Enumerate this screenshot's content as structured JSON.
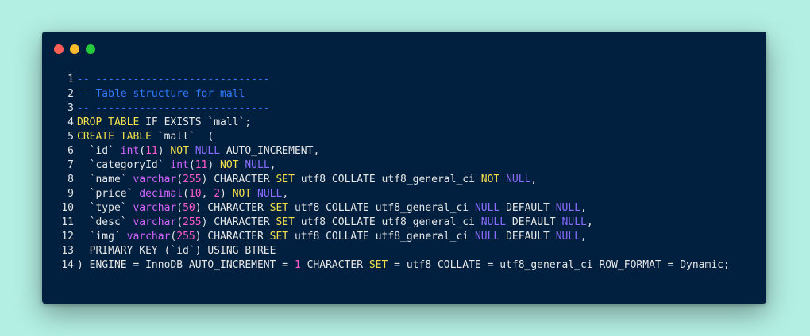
{
  "window": {
    "controls": [
      {
        "name": "close",
        "color": "#ff5f56"
      },
      {
        "name": "minimize",
        "color": "#ffbd2e"
      },
      {
        "name": "maximize",
        "color": "#27c93f"
      }
    ]
  },
  "code": {
    "line_numbers": [
      "1",
      "2",
      "3",
      "4",
      "5",
      "6",
      "7",
      "8",
      "9",
      "10",
      "11",
      "12",
      "13",
      "14"
    ],
    "lines": [
      {
        "segments": [
          {
            "t": "-- ----------------------------",
            "c": "comment"
          }
        ]
      },
      {
        "segments": [
          {
            "t": "-- Table structure for mall",
            "c": "comment"
          }
        ]
      },
      {
        "segments": [
          {
            "t": "-- ----------------------------",
            "c": "comment"
          }
        ]
      },
      {
        "segments": [
          {
            "t": "DROP TABLE",
            "c": "kw"
          },
          {
            "t": " IF EXISTS `mall`;",
            "c": "plain"
          }
        ]
      },
      {
        "segments": [
          {
            "t": "CREATE TABLE",
            "c": "kw"
          },
          {
            "t": " `mall`  (",
            "c": "plain"
          }
        ]
      },
      {
        "segments": [
          {
            "t": "  `id` ",
            "c": "plain"
          },
          {
            "t": "int",
            "c": "type"
          },
          {
            "t": "(",
            "c": "plain"
          },
          {
            "t": "11",
            "c": "num"
          },
          {
            "t": ") ",
            "c": "plain"
          },
          {
            "t": "NOT",
            "c": "kw"
          },
          {
            "t": " ",
            "c": "plain"
          },
          {
            "t": "NULL",
            "c": "null"
          },
          {
            "t": " AUTO_INCREMENT,",
            "c": "plain"
          }
        ]
      },
      {
        "segments": [
          {
            "t": "  `categoryId` ",
            "c": "plain"
          },
          {
            "t": "int",
            "c": "type"
          },
          {
            "t": "(",
            "c": "plain"
          },
          {
            "t": "11",
            "c": "num"
          },
          {
            "t": ") ",
            "c": "plain"
          },
          {
            "t": "NOT",
            "c": "kw"
          },
          {
            "t": " ",
            "c": "plain"
          },
          {
            "t": "NULL",
            "c": "null"
          },
          {
            "t": ",",
            "c": "plain"
          }
        ]
      },
      {
        "segments": [
          {
            "t": "  `name` ",
            "c": "plain"
          },
          {
            "t": "varchar",
            "c": "type"
          },
          {
            "t": "(",
            "c": "plain"
          },
          {
            "t": "255",
            "c": "num"
          },
          {
            "t": ") CHARACTER ",
            "c": "plain"
          },
          {
            "t": "SET",
            "c": "kw"
          },
          {
            "t": " utf8 COLLATE utf8_general_ci ",
            "c": "plain"
          },
          {
            "t": "NOT",
            "c": "kw"
          },
          {
            "t": " ",
            "c": "plain"
          },
          {
            "t": "NULL",
            "c": "null"
          },
          {
            "t": ",",
            "c": "plain"
          }
        ]
      },
      {
        "segments": [
          {
            "t": "  `price` ",
            "c": "plain"
          },
          {
            "t": "decimal",
            "c": "type"
          },
          {
            "t": "(",
            "c": "plain"
          },
          {
            "t": "10",
            "c": "num"
          },
          {
            "t": ", ",
            "c": "plain"
          },
          {
            "t": "2",
            "c": "num"
          },
          {
            "t": ") ",
            "c": "plain"
          },
          {
            "t": "NOT",
            "c": "kw"
          },
          {
            "t": " ",
            "c": "plain"
          },
          {
            "t": "NULL",
            "c": "null"
          },
          {
            "t": ",",
            "c": "plain"
          }
        ]
      },
      {
        "segments": [
          {
            "t": "  `type` ",
            "c": "plain"
          },
          {
            "t": "varchar",
            "c": "type"
          },
          {
            "t": "(",
            "c": "plain"
          },
          {
            "t": "50",
            "c": "num"
          },
          {
            "t": ") CHARACTER ",
            "c": "plain"
          },
          {
            "t": "SET",
            "c": "kw"
          },
          {
            "t": " utf8 COLLATE utf8_general_ci ",
            "c": "plain"
          },
          {
            "t": "NULL",
            "c": "null"
          },
          {
            "t": " DEFAULT ",
            "c": "plain"
          },
          {
            "t": "NULL",
            "c": "null"
          },
          {
            "t": ",",
            "c": "plain"
          }
        ]
      },
      {
        "segments": [
          {
            "t": "  `desc` ",
            "c": "plain"
          },
          {
            "t": "varchar",
            "c": "type"
          },
          {
            "t": "(",
            "c": "plain"
          },
          {
            "t": "255",
            "c": "num"
          },
          {
            "t": ") CHARACTER ",
            "c": "plain"
          },
          {
            "t": "SET",
            "c": "kw"
          },
          {
            "t": " utf8 COLLATE utf8_general_ci ",
            "c": "plain"
          },
          {
            "t": "NULL",
            "c": "null"
          },
          {
            "t": " DEFAULT ",
            "c": "plain"
          },
          {
            "t": "NULL",
            "c": "null"
          },
          {
            "t": ",",
            "c": "plain"
          }
        ]
      },
      {
        "segments": [
          {
            "t": "  `img` ",
            "c": "plain"
          },
          {
            "t": "varchar",
            "c": "type"
          },
          {
            "t": "(",
            "c": "plain"
          },
          {
            "t": "255",
            "c": "num"
          },
          {
            "t": ") CHARACTER ",
            "c": "plain"
          },
          {
            "t": "SET",
            "c": "kw"
          },
          {
            "t": " utf8 COLLATE utf8_general_ci ",
            "c": "plain"
          },
          {
            "t": "NULL",
            "c": "null"
          },
          {
            "t": " DEFAULT ",
            "c": "plain"
          },
          {
            "t": "NULL",
            "c": "null"
          },
          {
            "t": ",",
            "c": "plain"
          }
        ]
      },
      {
        "segments": [
          {
            "t": "  PRIMARY KEY (`id`) USING BTREE",
            "c": "plain"
          }
        ]
      },
      {
        "segments": [
          {
            "t": ") ENGINE = InnoDB AUTO_INCREMENT = ",
            "c": "plain"
          },
          {
            "t": "1",
            "c": "num"
          },
          {
            "t": " CHARACTER ",
            "c": "plain"
          },
          {
            "t": "SET",
            "c": "kw"
          },
          {
            "t": " = utf8 COLLATE = utf8_general_ci ROW_FORMAT = Dynamic;",
            "c": "plain"
          }
        ]
      }
    ]
  },
  "colors": {
    "background": "#b3efe3",
    "editor_bg": "#011f3e",
    "comment": "#2f7bff",
    "keyword": "#f4e04d",
    "type": "#d566ff",
    "number": "#ff5ccf",
    "null": "#8b6cff",
    "text": "#e6e6e6"
  }
}
